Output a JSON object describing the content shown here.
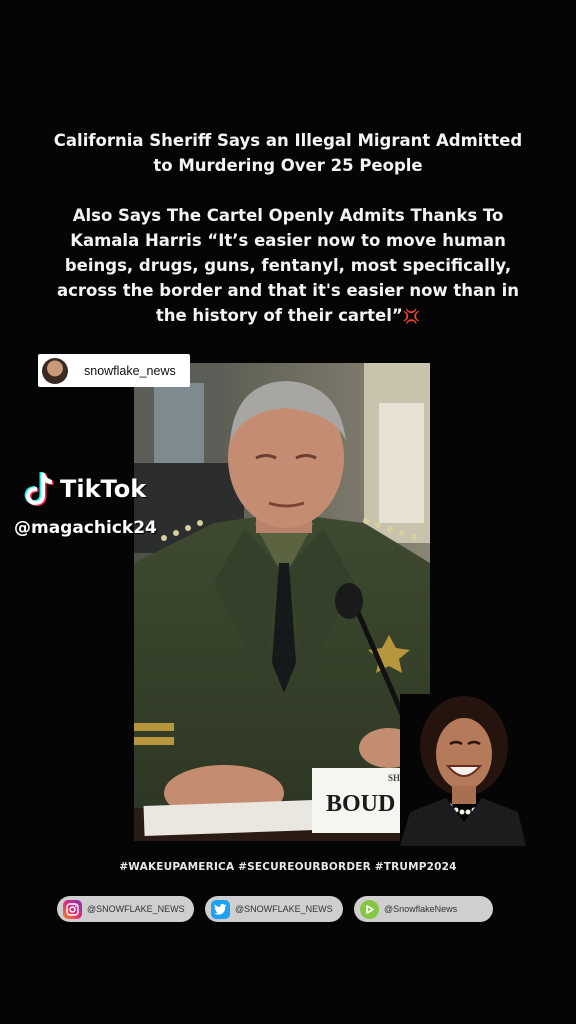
{
  "headline": {
    "line1": "California Sheriff Says an Illegal Migrant Admitted",
    "line2": "to Murdering Over 25 People",
    "line3": "Also Says The Cartel Openly Admits Thanks To",
    "line4": "Kamala Harris “It’s easier now to move human",
    "line5": "beings, drugs, guns, fentanyl, most specifically,",
    "line6": "across the border and that it's easier now than in",
    "line7": "the history of their cartel”",
    "emoji": "💢"
  },
  "source": {
    "username": "snowflake_news"
  },
  "video": {
    "nameplate": "BOUD",
    "nameplate_top": "SHER"
  },
  "tiktok": {
    "brand": "TikTok",
    "handle": "@magachick24"
  },
  "hashtags": "#WAKEUPAMERICA #SECUREOURBORDER  #TRUMP2024",
  "socials": [
    {
      "platform": "instagram-icon",
      "label": "@SNOWFLAKE_NEWS",
      "color": "#d62976"
    },
    {
      "platform": "twitter-icon",
      "label": "@SNOWFLAKE_NEWS",
      "color": "#1da1f2"
    },
    {
      "platform": "rumble-icon",
      "label": "@SnowflakeNews",
      "color": "#85c742"
    }
  ]
}
